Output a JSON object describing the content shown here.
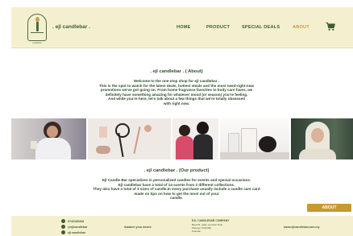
{
  "nav": {
    "brand": ". ejl candlebar .",
    "items": [
      {
        "label": "HOME"
      },
      {
        "label": "PRODUCT"
      },
      {
        "label": "SPECIAL DEALS"
      },
      {
        "label": "ABOUT"
      }
    ],
    "logo_caption": "candlebar"
  },
  "about": {
    "title": ". ejl candlebar . ( About)",
    "lines": [
      "Welcome to the one-stop shop for ejl candlebar .",
      "This is the spot to watch for the latest deals, hottest steals and the most need-right-now",
      "promotions we've got going on. From home fragrance favorites to body care faves, we",
      "definitely have something amazing for whatever mood (or season) you're feeling.",
      "And while you're here, let's talk about a few things that we're totally obsessed",
      "with right now."
    ]
  },
  "product": {
    "title": ". ejl candlebar . (Our product)",
    "lines": [
      "Ejl Candle Bar specializes in personalized candles for events and special occasions.",
      "Ejl candlebar have a total of 14 scents from 2 different collections.",
      "They also have a total of 3 sizes of candle.In every purchase usually include a candle care card",
      "made on tips on how to get the most out of your",
      "candle."
    ],
    "button_label": "ABOUT"
  },
  "footer": {
    "phone": "0742165438",
    "instagram": "@ejlcandlebar",
    "facebook": "ejl candlebar",
    "tagline": "Awaken your desire",
    "company": "EJL CANDLESAR COMPANY",
    "address_1": "Block B, Jalan Lanchan Pulu",
    "address_2": "Pahang 70-6(666)",
    "address_3": "Kuantan",
    "website": "www.ejlcandlebar.com.my"
  },
  "colors": {
    "nav_bg": "#f4f0cf",
    "brand_green": "#3f5c33",
    "accent_gold": "#c79a2e"
  }
}
